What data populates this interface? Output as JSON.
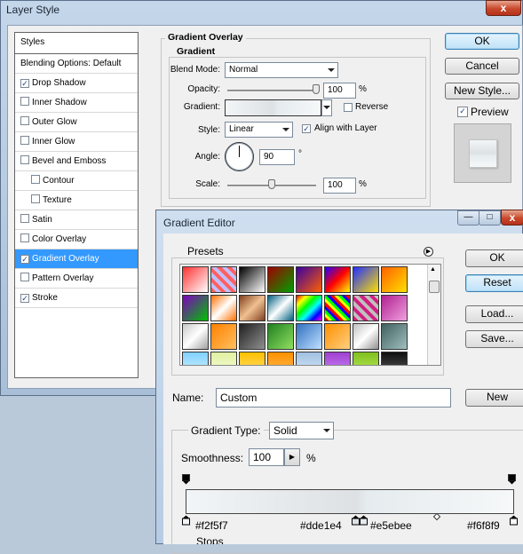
{
  "layer_style": {
    "title": "Layer Style",
    "close_glyph": "x",
    "styles_header": "Styles",
    "items": [
      {
        "label": "Blending Options: Default",
        "checkbox": false,
        "checked": false,
        "selected": false
      },
      {
        "label": "Drop Shadow",
        "checkbox": true,
        "checked": true,
        "selected": false
      },
      {
        "label": "Inner Shadow",
        "checkbox": true,
        "checked": false,
        "selected": false
      },
      {
        "label": "Outer Glow",
        "checkbox": true,
        "checked": false,
        "selected": false
      },
      {
        "label": "Inner Glow",
        "checkbox": true,
        "checked": false,
        "selected": false
      },
      {
        "label": "Bevel and Emboss",
        "checkbox": true,
        "checked": false,
        "selected": false
      },
      {
        "label": "Contour",
        "checkbox": true,
        "checked": false,
        "selected": false,
        "indent": true
      },
      {
        "label": "Texture",
        "checkbox": true,
        "checked": false,
        "selected": false,
        "indent": true
      },
      {
        "label": "Satin",
        "checkbox": true,
        "checked": false,
        "selected": false
      },
      {
        "label": "Color Overlay",
        "checkbox": true,
        "checked": false,
        "selected": false
      },
      {
        "label": "Gradient Overlay",
        "checkbox": true,
        "checked": true,
        "selected": true
      },
      {
        "label": "Pattern Overlay",
        "checkbox": true,
        "checked": false,
        "selected": false
      },
      {
        "label": "Stroke",
        "checkbox": true,
        "checked": true,
        "selected": false
      }
    ],
    "overlay": {
      "group_title": "Gradient Overlay",
      "sub_title": "Gradient",
      "blend_mode_label": "Blend Mode:",
      "blend_mode_value": "Normal",
      "opacity_label": "Opacity:",
      "opacity_value": "100",
      "opacity_level": 1.0,
      "percent": "%",
      "gradient_label": "Gradient:",
      "reverse_label": "Reverse",
      "reverse_checked": false,
      "style_label": "Style:",
      "style_value": "Linear",
      "align_label": "Align with Layer",
      "align_checked": true,
      "angle_label": "Angle:",
      "angle_value": "90",
      "degree": "°",
      "scale_label": "Scale:",
      "scale_value": "100",
      "scale_level": 0.5
    },
    "buttons": {
      "ok": "OK",
      "cancel": "Cancel",
      "new_style": "New Style...",
      "preview_label": "Preview",
      "preview_checked": true
    }
  },
  "gradient_editor": {
    "title": "Gradient Editor",
    "presets_label": "Presets",
    "buttons": {
      "ok": "OK",
      "reset": "Reset",
      "load": "Load...",
      "save": "Save...",
      "new": "New"
    },
    "name_label": "Name:",
    "name_value": "Custom",
    "type_label": "Gradient Type:",
    "type_value": "Solid",
    "smoothness_label": "Smoothness:",
    "smoothness_value": "100",
    "percent": "%",
    "stops": [
      {
        "label": "#f2f5f7",
        "color": "#f2f5f7"
      },
      {
        "label": "#dde1e4",
        "color": "#dde1e4"
      },
      {
        "label": "#e5ebee",
        "color": "#e5ebee"
      },
      {
        "label": "#f6f8f9",
        "color": "#f6f8f9"
      }
    ],
    "stops_label": "Stops",
    "swatches": [
      "linear-gradient(135deg,#ff3030,#fff)",
      "repeating-linear-gradient(45deg,#ff6060 0 4px,#c0c0ff 4px 8px)",
      "linear-gradient(135deg,#000,#fff)",
      "linear-gradient(135deg,#a00000,#00a000)",
      "linear-gradient(135deg,#3a00a0,#ff6000)",
      "linear-gradient(135deg,#2000ff,#ff0000,#ffff00)",
      "linear-gradient(135deg,#2030ff,#ffe000)",
      "linear-gradient(135deg,#ff6000,#ffe000)",
      "linear-gradient(135deg,#8000c0,#00c000)",
      "linear-gradient(135deg,#ff7000,#ffffff 50%,#ff7000)",
      "linear-gradient(135deg,#804020,#f0c090,#804020)",
      "linear-gradient(135deg,#006080,#fff,#006080)",
      "linear-gradient(135deg,#ff0000,#ff0,#0f0,#0ff,#00f,#f0f)",
      "repeating-linear-gradient(45deg,#f00 0 3px,#ff0 3px 6px,#0f0 6px 9px,#00f 9px 12px)",
      "repeating-linear-gradient(45deg,#d02080 0 4px,#c0c0c0 4px 8px)",
      "linear-gradient(135deg,#b02090,#f0a0e0)",
      "linear-gradient(135deg,#c8c8c8,#fff,#a0a0a0)",
      "linear-gradient(135deg,#ff8000,#ffc060)",
      "linear-gradient(135deg,#202020,#909090)",
      "linear-gradient(135deg,#208020,#90e060)",
      "linear-gradient(135deg,#3070c0,#c0e0ff)",
      "linear-gradient(135deg,#ff9000,#ffd080)",
      "linear-gradient(135deg,#c0c0c0,#fff,#909090)",
      "linear-gradient(135deg,#406060,#a0c0c0)",
      "linear-gradient(180deg,#80d0ff,#e0f6ff)",
      "linear-gradient(180deg,#e0f0a0,#f8ffe0)",
      "linear-gradient(180deg,#ffc000,#ffe080)",
      "linear-gradient(180deg,#ff9000,#ffc060)",
      "linear-gradient(180deg,#a0c0e0,#e0eeff)",
      "linear-gradient(180deg,#a040d0,#d090ff)",
      "linear-gradient(180deg,#80c020,#c0f060)",
      "linear-gradient(180deg,#101010,#606060)"
    ]
  }
}
